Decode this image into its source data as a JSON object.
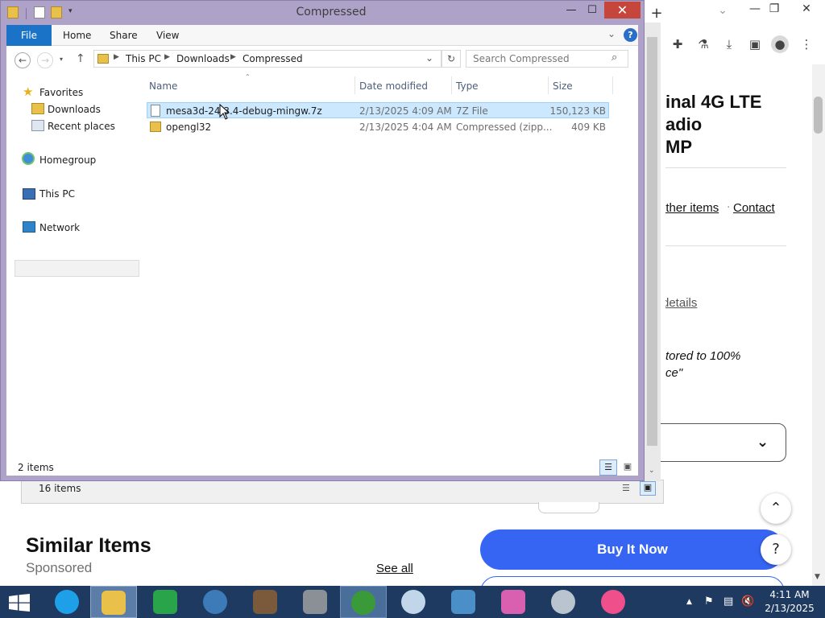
{
  "explorer": {
    "title": "Compressed",
    "ribbon": {
      "file": "File",
      "home": "Home",
      "share": "Share",
      "view": "View"
    },
    "breadcrumb": [
      "This PC",
      "Downloads",
      "Compressed"
    ],
    "search_placeholder": "Search Compressed",
    "nav": {
      "favorites": "Favorites",
      "downloads": "Downloads",
      "recent": "Recent places",
      "homegroup": "Homegroup",
      "thispc": "This PC",
      "network": "Network"
    },
    "columns": {
      "name": "Name",
      "date": "Date modified",
      "type": "Type",
      "size": "Size"
    },
    "files": [
      {
        "name": "mesa3d-24.3.4-debug-mingw.7z",
        "date": "2/13/2025 4:09 AM",
        "type": "7Z File",
        "size": "150,123 KB"
      },
      {
        "name": "opengl32",
        "date": "2/13/2025 4:04 AM",
        "type": "Compressed (zipp...",
        "size": "409 KB"
      }
    ],
    "status": "2 items"
  },
  "explorer_behind": {
    "status": "16 items"
  },
  "browser": {
    "product_title": [
      "inal 4G LTE",
      "adio",
      "MP"
    ],
    "links": {
      "other_items": "other items",
      "contact": "Contact",
      "details": "details"
    },
    "quote": [
      "tored to 100%",
      "ce\""
    ],
    "similar_title": "Similar Items",
    "sponsored": "Sponsored",
    "see_all": "See all",
    "buy_now": "Buy It Now",
    "help": "?"
  },
  "taskbar": {
    "time": "4:11 AM",
    "date": "2/13/2025"
  },
  "colors": {
    "window_border": "#aea2c8",
    "file_tab": "#1a73c6",
    "selection": "#cce8ff",
    "taskbar": "#1f3a61",
    "buy_button": "#3665f3",
    "close_button": "#c7463c"
  }
}
